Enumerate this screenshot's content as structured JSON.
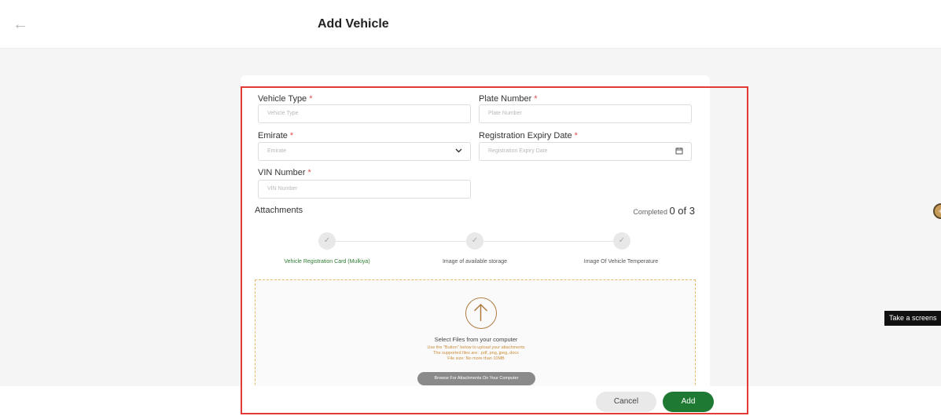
{
  "header": {
    "back_icon": "arrow-left-icon",
    "title": "Add Vehicle"
  },
  "form": {
    "vehicle_type": {
      "label": "Vehicle Type",
      "required": "*",
      "placeholder": "Vehicle Type"
    },
    "plate_number": {
      "label": "Plate Number",
      "required": "*",
      "placeholder": "Plate Number"
    },
    "emirate": {
      "label": "Emirate",
      "required": "*",
      "placeholder": "Emirate",
      "icon": "chevron-down-icon"
    },
    "registration_expiry": {
      "label": "Registration Expiry Date",
      "required": "*",
      "placeholder": "Registration Expiry Date",
      "icon": "calendar-icon"
    },
    "vin_number": {
      "label": "VIN Number",
      "required": "*",
      "placeholder": "VIN Number"
    }
  },
  "attachments": {
    "title": "Attachments",
    "completed_prefix": "Completed",
    "completed_value": "0 of 3",
    "steps": [
      {
        "label": "Vehicle Registration Card (Mulkiya)",
        "active": true
      },
      {
        "label": "Image of available storage",
        "active": false
      },
      {
        "label": "Image Of Vehicle Temperature",
        "active": false
      }
    ],
    "step_icon": "check-icon",
    "dropzone": {
      "icon": "upload-arrow-icon",
      "title": "Select Files from your computer",
      "note_1": "Use the \"Button\" below to upload your attachments",
      "note_2": "The supported files are: .pdf,.png,.jpeg,.docx",
      "note_3": "File size: No more than 10MB",
      "browse_label": "Browse For Attachments On Your Computer"
    }
  },
  "footer": {
    "cancel_label": "Cancel",
    "add_label": "Add"
  },
  "overlay": {
    "tooltip": "Take a screens"
  },
  "colors": {
    "accent_green": "#1e7a32",
    "highlight_red": "#e53935",
    "note_orange": "#c98b39",
    "required_red": "#e05050"
  }
}
